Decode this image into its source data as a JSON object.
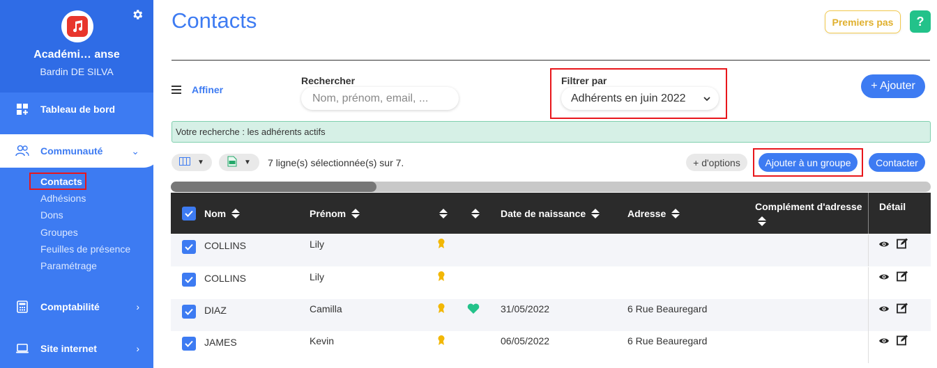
{
  "sidebar": {
    "org_name": "Académi… anse",
    "user_name": "Bardin DE SILVA",
    "nav": {
      "dashboard": "Tableau de bord",
      "community": "Communauté",
      "accounting": "Comptabilité",
      "website": "Site internet"
    },
    "sub_items": [
      "Contacts",
      "Adhésions",
      "Dons",
      "Groupes",
      "Feuilles de présence",
      "Paramétrage"
    ]
  },
  "header": {
    "title": "Contacts",
    "premiers_pas": "Premiers pas",
    "help": "?"
  },
  "filters": {
    "affiner": "Affiner",
    "search_label": "Rechercher",
    "search_placeholder": "Nom, prénom, email, ...",
    "filter_label": "Filtrer par",
    "filter_value": "Adhérents en juin 2022",
    "add_button": "+ Ajouter"
  },
  "banner": "Votre recherche : les adhérents actifs",
  "toolbar": {
    "selection_text": "7 ligne(s) sélectionnée(s) sur 7.",
    "more_options": "+ d'options",
    "add_to_group": "Ajouter à un groupe",
    "contact": "Contacter"
  },
  "table": {
    "headers": {
      "nom": "Nom",
      "prenom": "Prénom",
      "dob": "Date de naissance",
      "address": "Adresse",
      "address_complement": "Complément d'adresse",
      "detail": "Détail"
    },
    "rows": [
      {
        "nom": "COLLINS",
        "prenom": "Lily",
        "badge": true,
        "heart": false,
        "dob": "",
        "address": ""
      },
      {
        "nom": "COLLINS",
        "prenom": "Lily",
        "badge": true,
        "heart": false,
        "dob": "",
        "address": ""
      },
      {
        "nom": "DIAZ",
        "prenom": "Camilla",
        "badge": true,
        "heart": true,
        "dob": "31/05/2022",
        "address": "6 Rue Beauregard"
      },
      {
        "nom": "JAMES",
        "prenom": "Kevin",
        "badge": true,
        "heart": false,
        "dob": "06/05/2022",
        "address": "6 Rue Beauregard"
      }
    ]
  },
  "colors": {
    "primary": "#3d7bf2",
    "sidebar_top": "#2f6ce6",
    "highlight_red": "#e8161b",
    "banner_bg": "#d6f0e6",
    "heart": "#23c28a",
    "badge": "#f2b705"
  }
}
